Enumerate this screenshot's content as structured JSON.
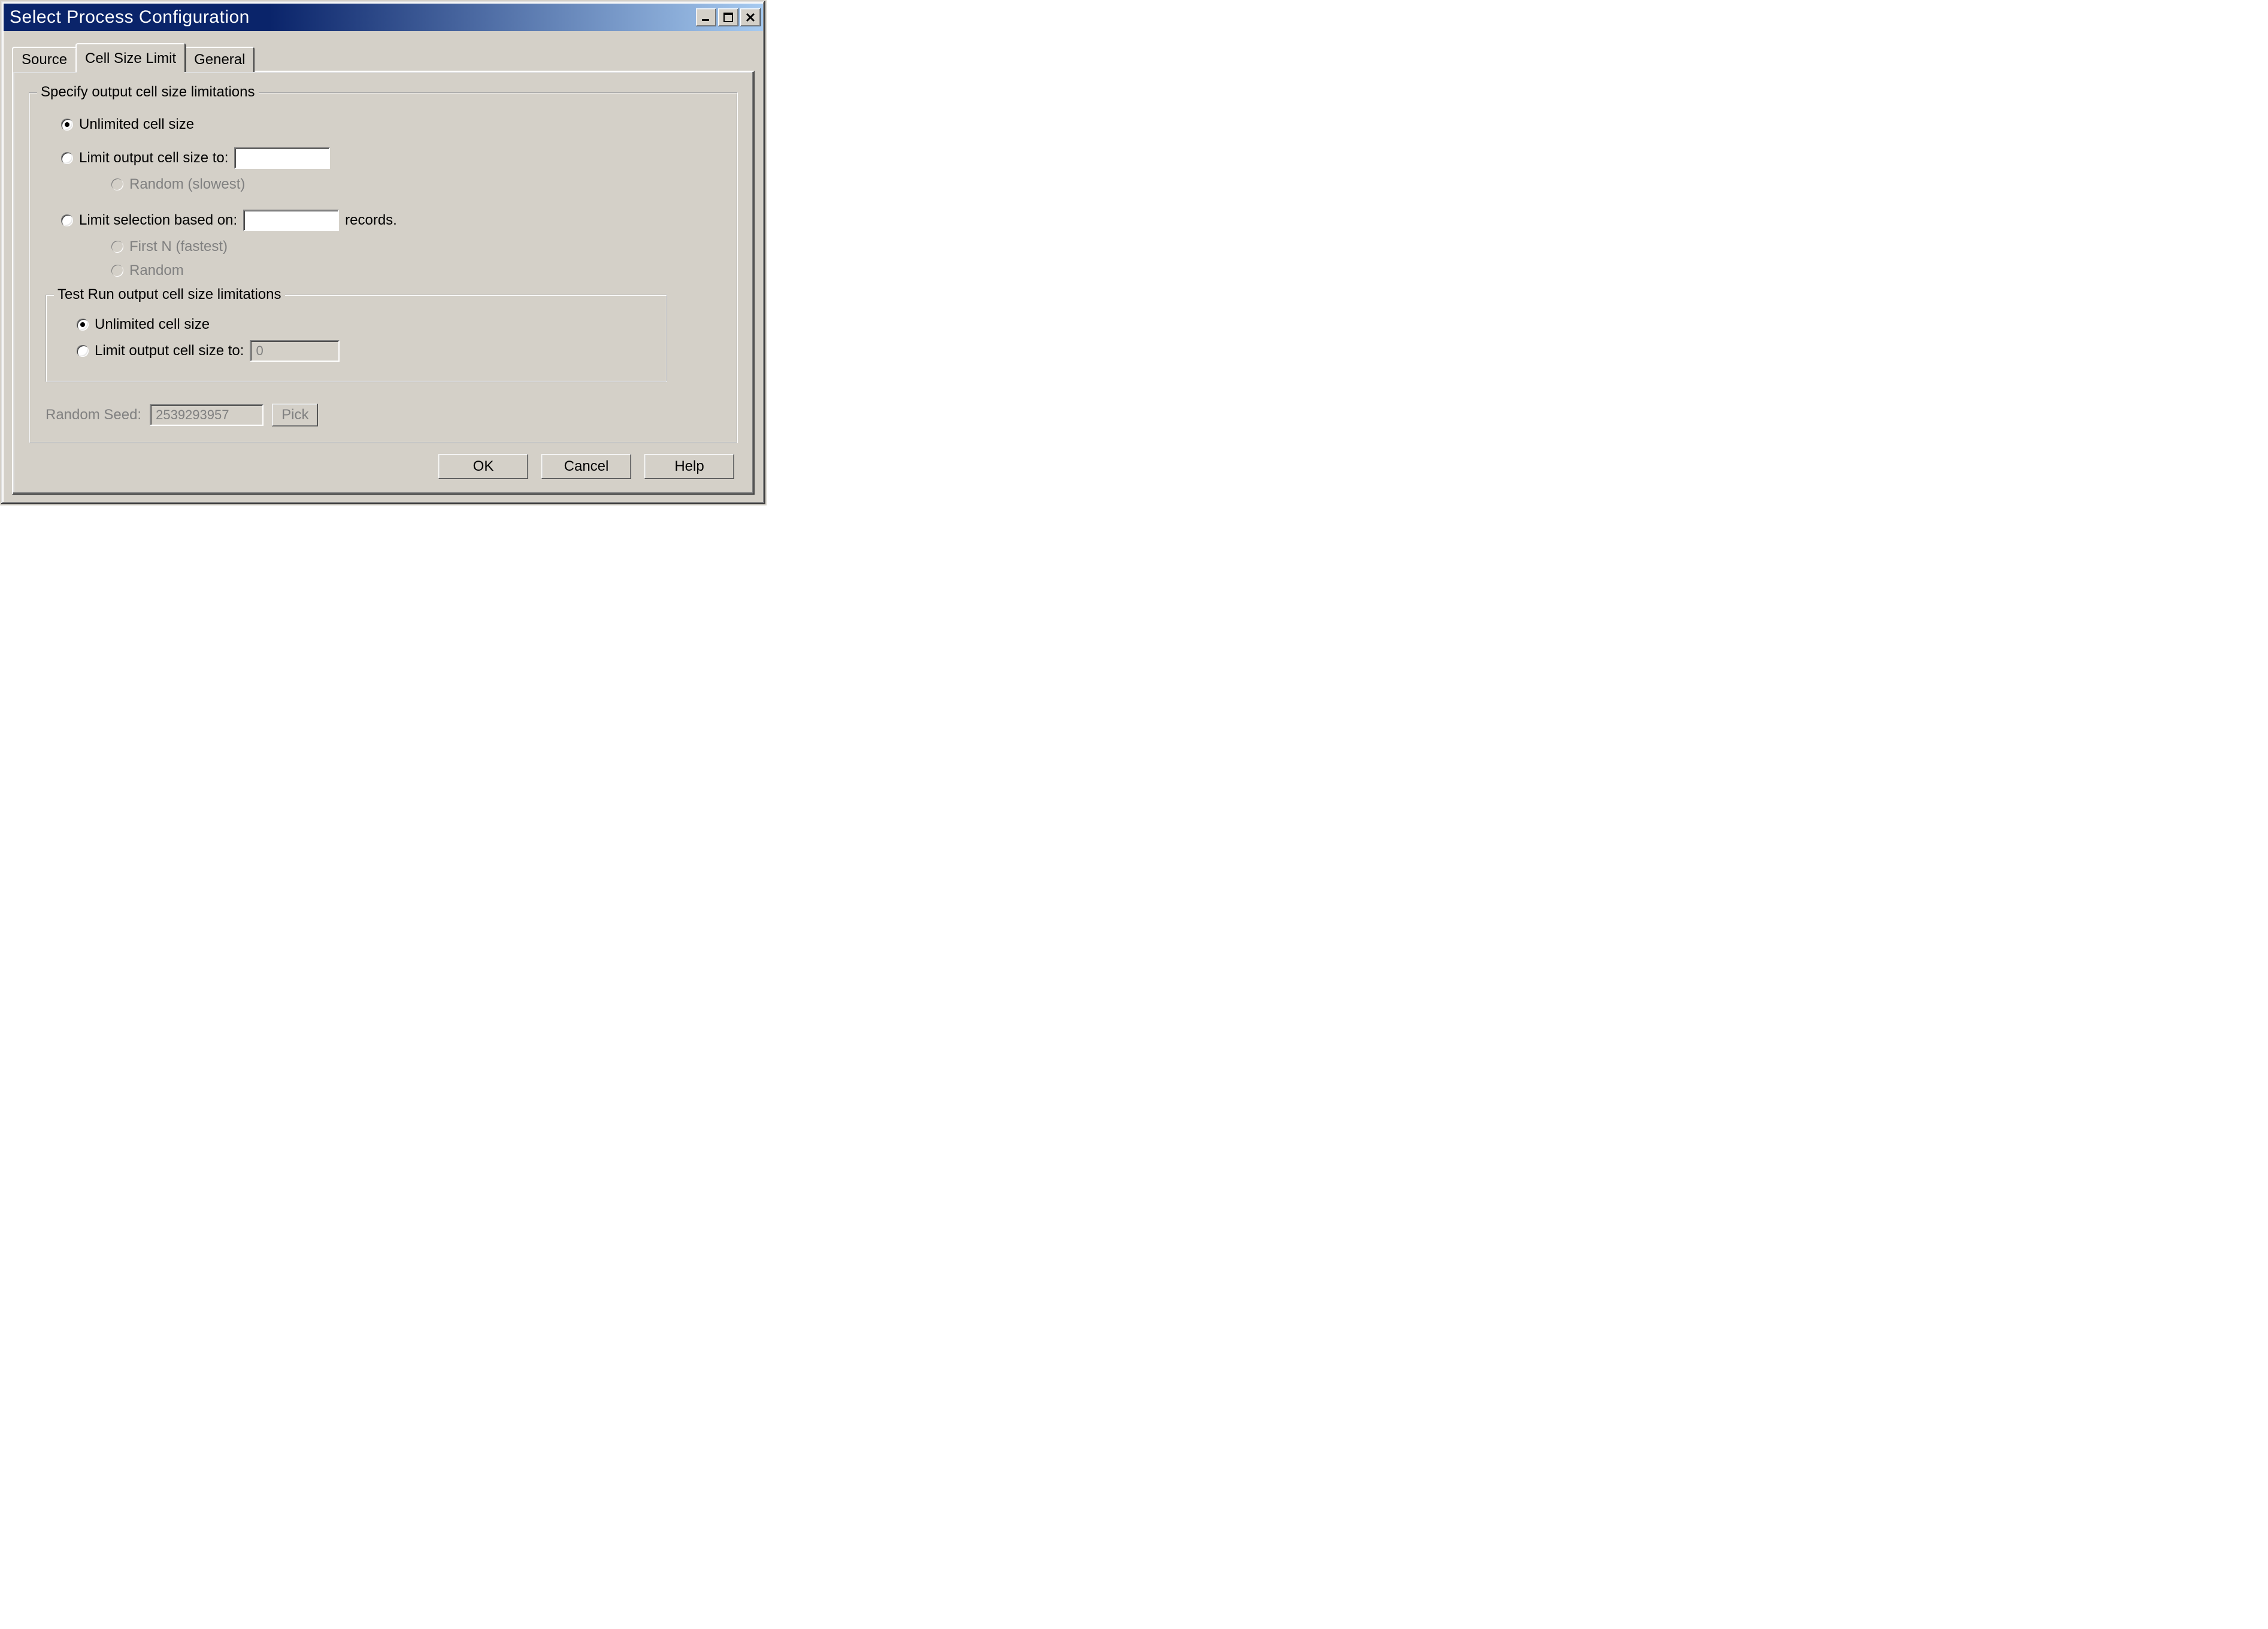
{
  "window": {
    "title": "Select Process Configuration"
  },
  "tabs": {
    "source": {
      "label": "Source"
    },
    "cellsize": {
      "label": "Cell Size Limit"
    },
    "general": {
      "label": "General"
    }
  },
  "group_main": {
    "legend": "Specify output cell size limitations",
    "opt_unlimited": "Unlimited cell size",
    "opt_limit_to": "Limit output cell size to:",
    "opt_limit_to_value": "",
    "sub_random_slowest": "Random (slowest)",
    "opt_limit_sel": "Limit selection based on:",
    "opt_limit_sel_value": "",
    "records_suffix": "records.",
    "sub_first_n": "First N (fastest)",
    "sub_random": "Random"
  },
  "group_testrun": {
    "legend": "Test Run output cell size limitations",
    "opt_unlimited": "Unlimited cell size",
    "opt_limit_to": "Limit output cell size to:",
    "limit_value": "0"
  },
  "random_seed": {
    "label": "Random Seed:",
    "value": "2539293957",
    "pick": "Pick"
  },
  "buttons": {
    "ok": "OK",
    "cancel": "Cancel",
    "help": "Help"
  }
}
